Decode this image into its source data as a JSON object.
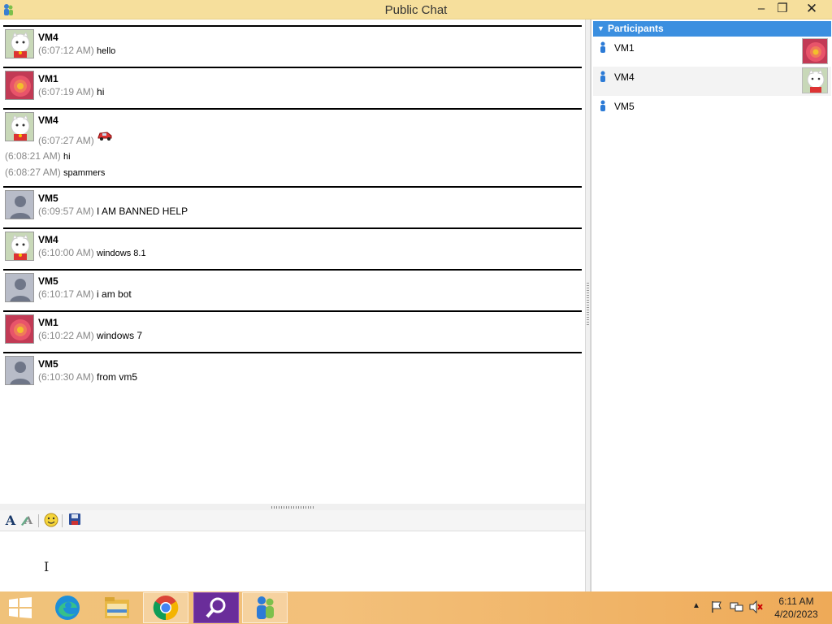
{
  "window": {
    "title": "Public Chat"
  },
  "messages": [
    {
      "sender": "VM4",
      "avatar": "lucky-cat",
      "lines": [
        {
          "time": "(6:07:12 AM)",
          "text": "hello"
        }
      ],
      "extra": []
    },
    {
      "sender": "VM1",
      "avatar": "flower",
      "lines": [
        {
          "time": "(6:07:19 AM)",
          "text": "hi"
        }
      ],
      "extra": []
    },
    {
      "sender": "VM4",
      "avatar": "lucky-cat",
      "lines": [
        {
          "time": "(6:07:27 AM)",
          "text": ""
        }
      ],
      "extra": [
        {
          "time": "(6:08:21 AM)",
          "text": "hi"
        },
        {
          "time": "(6:08:27 AM)",
          "text": "spammers"
        }
      ]
    },
    {
      "sender": "VM5",
      "avatar": "default-person",
      "lines": [
        {
          "time": "(6:09:57 AM)",
          "text": "I AM BANNED HELP"
        }
      ],
      "extra": []
    },
    {
      "sender": "VM4",
      "avatar": "lucky-cat",
      "lines": [
        {
          "time": "(6:10:00 AM)",
          "text": "windows 8.1"
        }
      ],
      "extra": []
    },
    {
      "sender": "VM5",
      "avatar": "default-person",
      "lines": [
        {
          "time": "(6:10:17 AM)",
          "text": "i am bot"
        }
      ],
      "extra": []
    },
    {
      "sender": "VM1",
      "avatar": "flower",
      "lines": [
        {
          "time": "(6:10:22 AM)",
          "text": "windows 7"
        }
      ],
      "extra": []
    },
    {
      "sender": "VM5",
      "avatar": "default-person",
      "lines": [
        {
          "time": "(6:10:30 AM)",
          "text": "from vm5"
        }
      ],
      "extra": []
    }
  ],
  "participants": {
    "header": "Participants",
    "list": [
      {
        "name": "VM1",
        "avatar": "flower"
      },
      {
        "name": "VM4",
        "avatar": "lucky-cat"
      },
      {
        "name": "VM5",
        "avatar": ""
      }
    ]
  },
  "taskbar": {
    "clock_time": "6:11 AM",
    "clock_date": "4/20/2023",
    "items": [
      "start-button",
      "edge-icon",
      "file-explorer-icon",
      "chrome-icon",
      "search-app-icon",
      "messenger-icon"
    ]
  },
  "colors": {
    "titlebar": "#f6df9c",
    "header": "#3b8fe0",
    "taskbar": "#f0c27a"
  }
}
